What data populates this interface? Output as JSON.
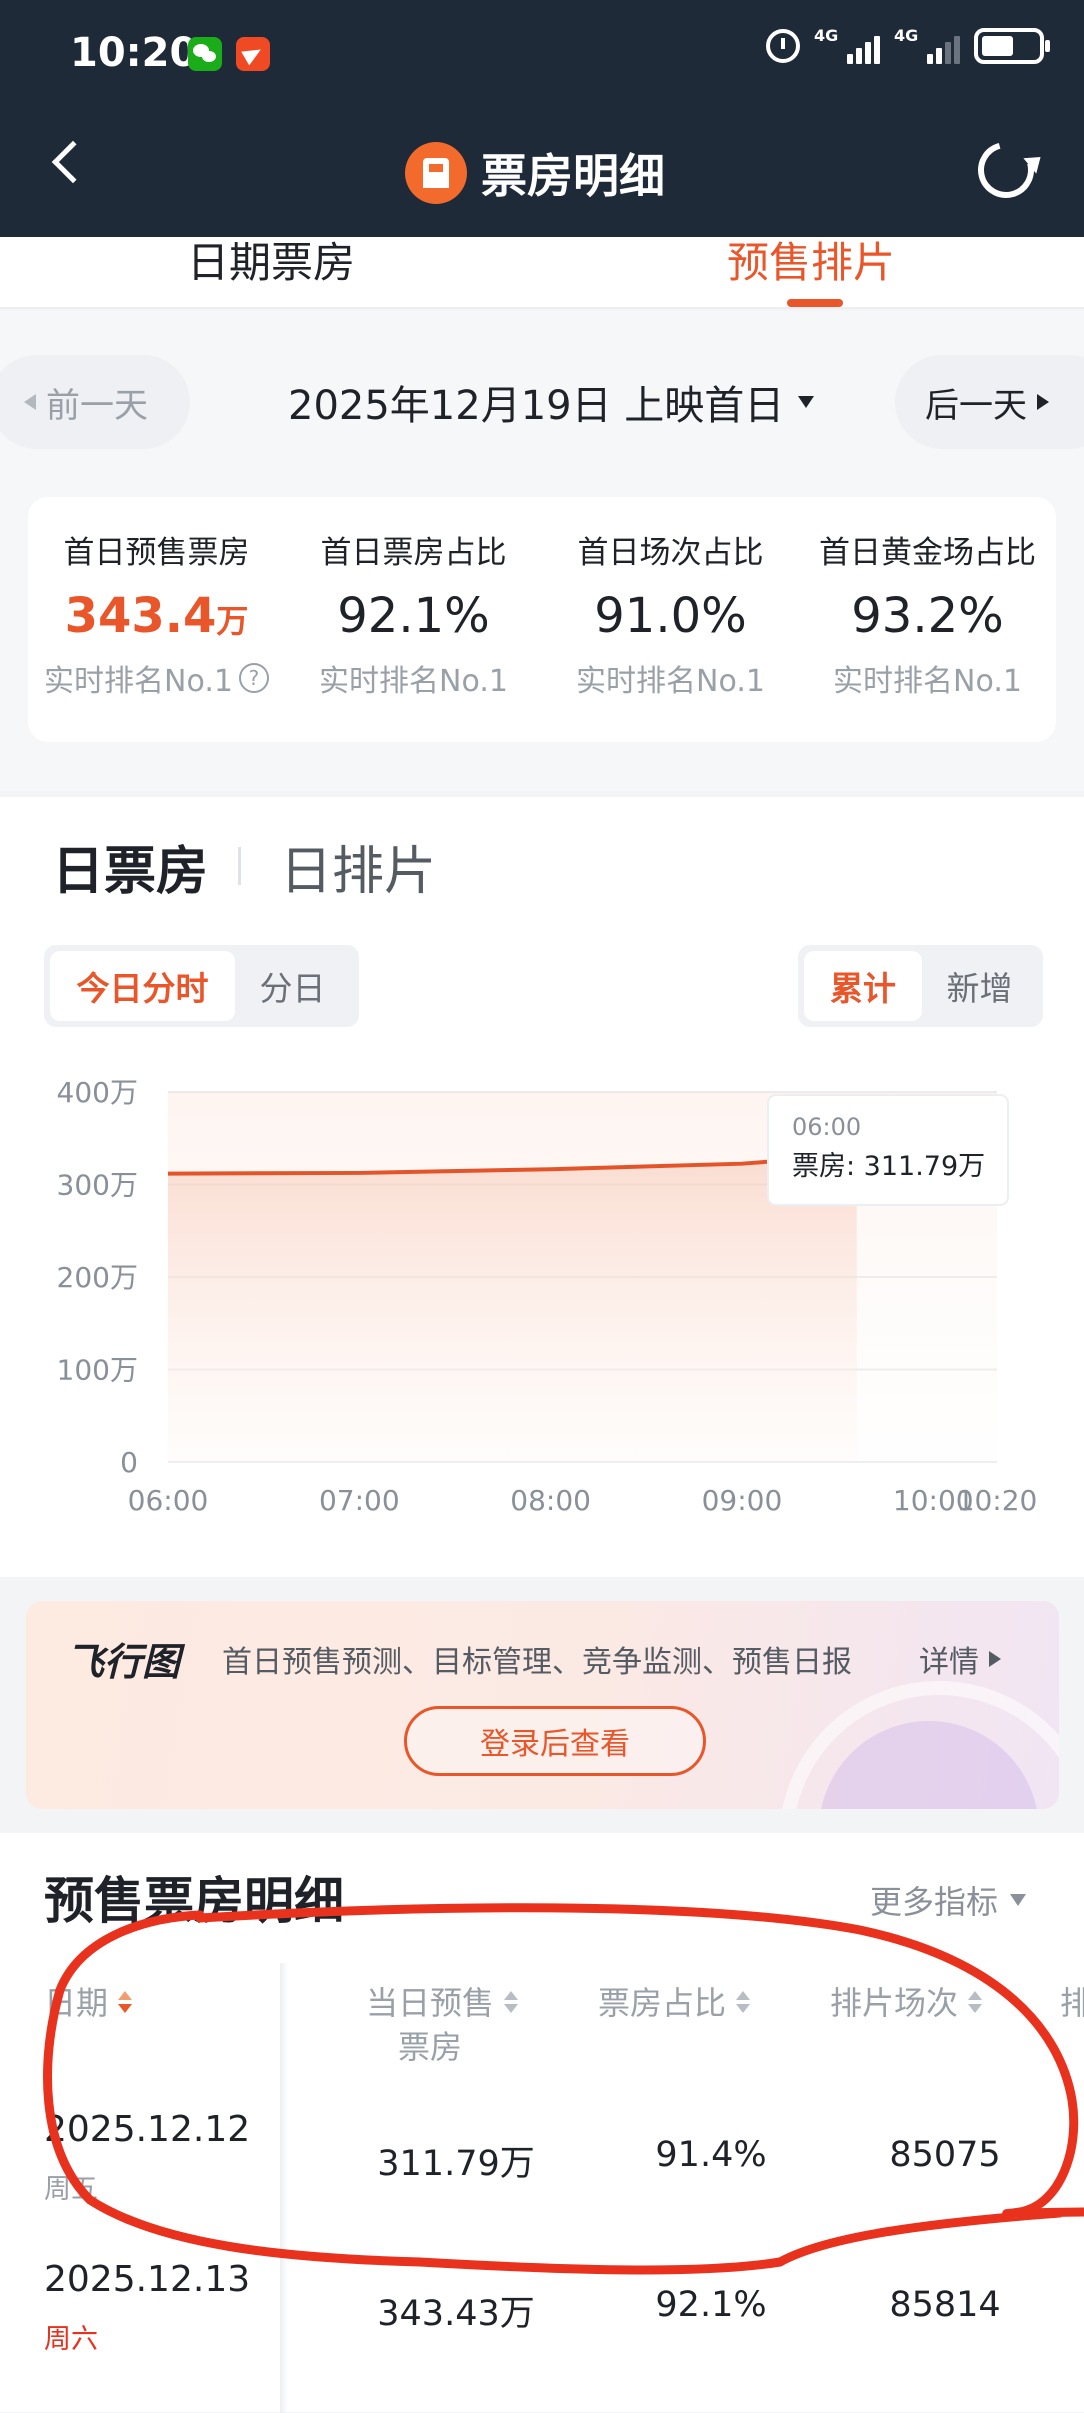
{
  "status_bar": {
    "time": "10:20",
    "icons": [
      "wechat-icon",
      "send-icon",
      "alarm-icon",
      "signal-4g-icon",
      "signal-4g-icon",
      "battery-icon"
    ],
    "network_labels": [
      "4G",
      "4G"
    ],
    "battery_level": 0.58
  },
  "header": {
    "title": "票房明细",
    "back_icon": "back-arrow-icon",
    "refresh_icon": "refresh-icon"
  },
  "tabs": [
    {
      "label": "日期票房",
      "active": false
    },
    {
      "label": "预售排片",
      "active": true
    }
  ],
  "date_nav": {
    "prev_label": "前一天",
    "current": "2025年12月19日 上映首日",
    "next_label": "后一天"
  },
  "stats": [
    {
      "label": "首日预售票房",
      "value": "343.4",
      "unit": "万",
      "rank": "实时排名No.1"
    },
    {
      "label": "首日票房占比",
      "value": "92.1%",
      "unit": "",
      "rank": "实时排名No.1"
    },
    {
      "label": "首日场次占比",
      "value": "91.0%",
      "unit": "",
      "rank": "实时排名No.1"
    },
    {
      "label": "首日黄金场占比",
      "value": "93.2%",
      "unit": "",
      "rank": "实时排名No.1"
    }
  ],
  "chart_section": {
    "tabs": [
      "日票房",
      "日排片"
    ],
    "time_toggle": [
      "今日分时",
      "分日"
    ],
    "mode_toggle": [
      "累计",
      "新增"
    ]
  },
  "chart_data": {
    "type": "area",
    "x": [
      "06:00",
      "07:00",
      "08:00",
      "09:00",
      "09:36"
    ],
    "values": [
      311.79,
      312.5,
      316.5,
      322.5,
      332.0
    ],
    "x_ticks": [
      "06:00",
      "07:00",
      "08:00",
      "09:00",
      "10:00",
      "10:20"
    ],
    "y_ticks": [
      "0",
      "100万",
      "200万",
      "300万",
      "400万"
    ],
    "ylim": [
      0,
      400
    ],
    "grid": true,
    "color": "#e3542a",
    "tooltip": {
      "time": "06:00",
      "label": "票房: 311.79万"
    }
  },
  "promo": {
    "brand": "飞行图",
    "text": "首日预售预测、目标管理、竞争监测、预售日报",
    "more": "详情",
    "button": "登录后查看"
  },
  "table": {
    "title": "预售票房明细",
    "more_metrics": "更多指标",
    "headers": {
      "date": "日期",
      "presale_1": "当日预售",
      "presale_2": "票房",
      "share": "票房占比",
      "shows": "排片场次",
      "extra": "排"
    },
    "rows": [
      {
        "date": "2025.12.12",
        "weekday": "周五",
        "presale": "311.79万",
        "share": "91.4%",
        "shows": "85075"
      },
      {
        "date": "2025.12.13",
        "weekday": "周六",
        "presale": "343.43万",
        "share": "92.1%",
        "shows": "85814"
      }
    ]
  },
  "colors": {
    "accent": "#e8562a",
    "header_bg": "#1f2a38",
    "annotation": "#e8321e"
  }
}
